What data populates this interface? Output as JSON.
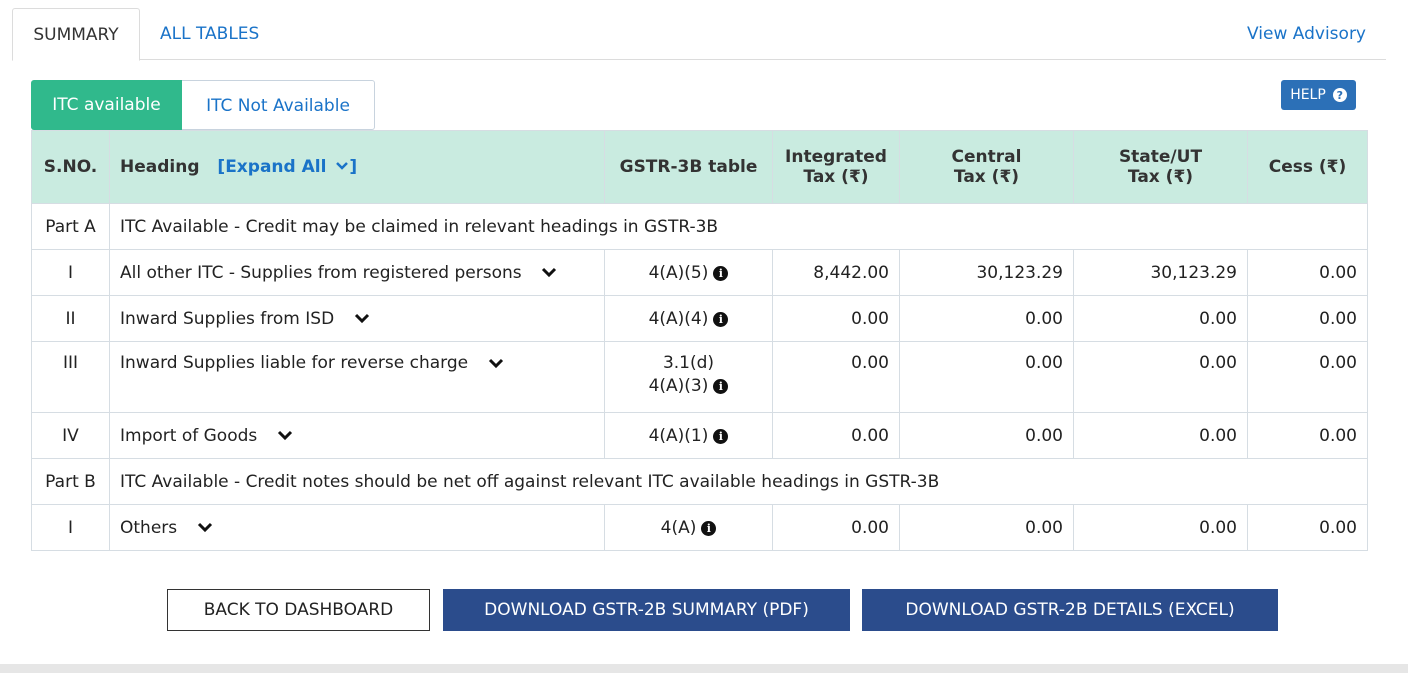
{
  "top_tabs": {
    "summary": "SUMMARY",
    "all_tables": "ALL TABLES",
    "view_advisory": "View Advisory"
  },
  "sub_tabs": {
    "itc_available": "ITC available",
    "itc_not_available": "ITC Not Available"
  },
  "help": {
    "label": "HELP",
    "icon": "?"
  },
  "table": {
    "headers": {
      "sno": "S.NO.",
      "heading": "Heading",
      "expand_all": "[Expand All",
      "gstr3b": "GSTR-3B table",
      "integrated_l1": "Integrated",
      "integrated_l2": "Tax (₹)",
      "central_l1": "Central",
      "central_l2": "Tax (₹)",
      "state_l1": "State/UT",
      "state_l2": "Tax (₹)",
      "cess": "Cess (₹)"
    },
    "part_a": {
      "label": "Part A",
      "text": "ITC Available - Credit may be claimed in relevant headings in GSTR-3B"
    },
    "part_a_rows": [
      {
        "sno": "I",
        "heading": "All other ITC - Supplies from registered persons",
        "gstr": "4(A)(5)",
        "igst": "8,442.00",
        "cgst": "30,123.29",
        "sgst": "30,123.29",
        "cess": "0.00"
      },
      {
        "sno": "II",
        "heading": "Inward Supplies from ISD",
        "gstr": "4(A)(4)",
        "igst": "0.00",
        "cgst": "0.00",
        "sgst": "0.00",
        "cess": "0.00"
      },
      {
        "sno": "III",
        "heading": "Inward Supplies liable for reverse charge",
        "gstr_l1": "3.1(d)",
        "gstr_l2": "4(A)(3)",
        "igst": "0.00",
        "cgst": "0.00",
        "sgst": "0.00",
        "cess": "0.00"
      },
      {
        "sno": "IV",
        "heading": "Import of Goods",
        "gstr": "4(A)(1)",
        "igst": "0.00",
        "cgst": "0.00",
        "sgst": "0.00",
        "cess": "0.00"
      }
    ],
    "part_b": {
      "label": "Part B",
      "text": "ITC Available - Credit notes should be net off against relevant ITC available headings in GSTR-3B"
    },
    "part_b_rows": [
      {
        "sno": "I",
        "heading": "Others",
        "gstr": "4(A)",
        "igst": "0.00",
        "cgst": "0.00",
        "sgst": "0.00",
        "cess": "0.00"
      }
    ]
  },
  "buttons": {
    "back": "BACK TO DASHBOARD",
    "download_pdf": "DOWNLOAD GSTR-2B SUMMARY (PDF)",
    "download_excel": "DOWNLOAD GSTR-2B DETAILS (EXCEL)"
  },
  "icons": {
    "info": "i",
    "chevron": "chevron-down-icon"
  },
  "colors": {
    "itc_available_bg": "#30b98c",
    "header_bg": "#c9ebe0",
    "link": "#1a73c8",
    "primary_button": "#2b4c8c",
    "help_button": "#2c70b7"
  }
}
